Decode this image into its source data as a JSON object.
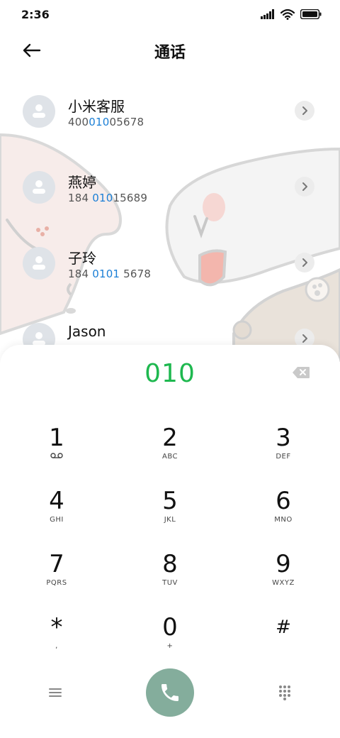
{
  "status_bar": {
    "time": "2:36"
  },
  "header": {
    "title": "通话"
  },
  "contacts": [
    {
      "name": "小米客服",
      "number_pre": "400",
      "number_hl": "010",
      "number_post": "05678"
    },
    {
      "name": "燕婷",
      "number_pre": "184 ",
      "number_hl": "010",
      "number_post": "15689"
    },
    {
      "name": "子玲",
      "number_pre": "184 ",
      "number_hl": "0101",
      "number_post": " 5678"
    },
    {
      "name": "Jason",
      "number_pre": "",
      "number_hl": "",
      "number_post": ""
    }
  ],
  "dialer": {
    "input": "010",
    "keys": [
      {
        "digit": "1",
        "letters": ""
      },
      {
        "digit": "2",
        "letters": "ABC"
      },
      {
        "digit": "3",
        "letters": "DEF"
      },
      {
        "digit": "4",
        "letters": "GHI"
      },
      {
        "digit": "5",
        "letters": "JKL"
      },
      {
        "digit": "6",
        "letters": "MNO"
      },
      {
        "digit": "7",
        "letters": "PQRS"
      },
      {
        "digit": "8",
        "letters": "TUV"
      },
      {
        "digit": "9",
        "letters": "WXYZ"
      },
      {
        "digit": "*",
        "letters": ","
      },
      {
        "digit": "0",
        "letters": "+"
      },
      {
        "digit": "#",
        "letters": ""
      }
    ],
    "key1_icon": "voicemail-icon"
  },
  "icons": {
    "back": "arrow-left-icon",
    "chevron": "chevron-right-icon",
    "backspace": "backspace-icon",
    "menu": "menu-icon",
    "call": "phone-icon",
    "keypad": "keypad-icon"
  },
  "colors": {
    "accent_green": "#1eb84f",
    "match_blue": "#1b7fd6",
    "call_button": "#84ad9c"
  }
}
